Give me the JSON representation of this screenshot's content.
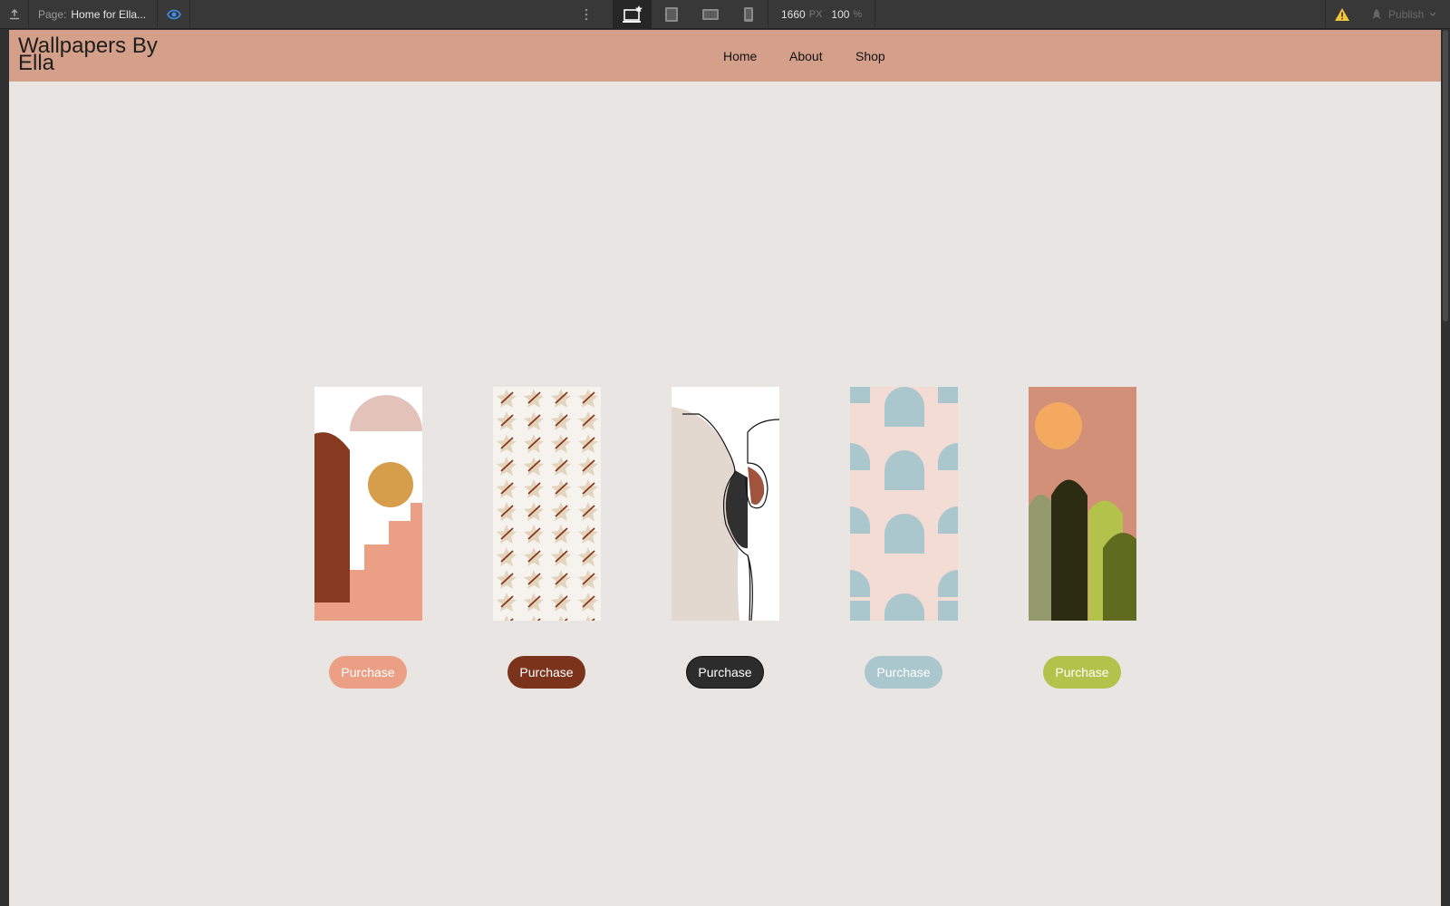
{
  "toolbar": {
    "page_label": "Page:",
    "page_name": "Home for Ella...",
    "width_value": "1660",
    "width_unit": "PX",
    "zoom_value": "100",
    "zoom_unit": "%",
    "publish_label": "Publish",
    "icons": {
      "export": "export-icon",
      "preview": "eye-icon",
      "more": "more-vertical-icon",
      "desktop": "desktop-star-icon",
      "tablet": "tablet-icon",
      "tablet_landscape": "tablet-landscape-icon",
      "mobile": "mobile-icon",
      "warning": "warning-icon",
      "publish": "rocket-icon",
      "publish_dropdown": "chevron-down-icon"
    }
  },
  "site": {
    "logo": "Wallpapers By Ella",
    "nav": [
      "Home",
      "About",
      "Shop"
    ],
    "header_color": "#d5a08a",
    "background": "#e9e5e2"
  },
  "products": [
    {
      "artwork": "arches-stairs-sun-icon",
      "button_label": "Purchase",
      "button_color": "#eb9f84"
    },
    {
      "artwork": "star-pattern-icon",
      "button_label": "Purchase",
      "button_color": "#7b341b"
    },
    {
      "artwork": "line-art-face-icon",
      "button_label": "Purchase",
      "button_color": "#2c2c2c"
    },
    {
      "artwork": "half-circle-pattern-icon",
      "button_label": "Purchase",
      "button_color": "#a9c7cc"
    },
    {
      "artwork": "cactus-sunset-icon",
      "button_label": "Purchase",
      "button_color": "#b3c24a"
    }
  ]
}
